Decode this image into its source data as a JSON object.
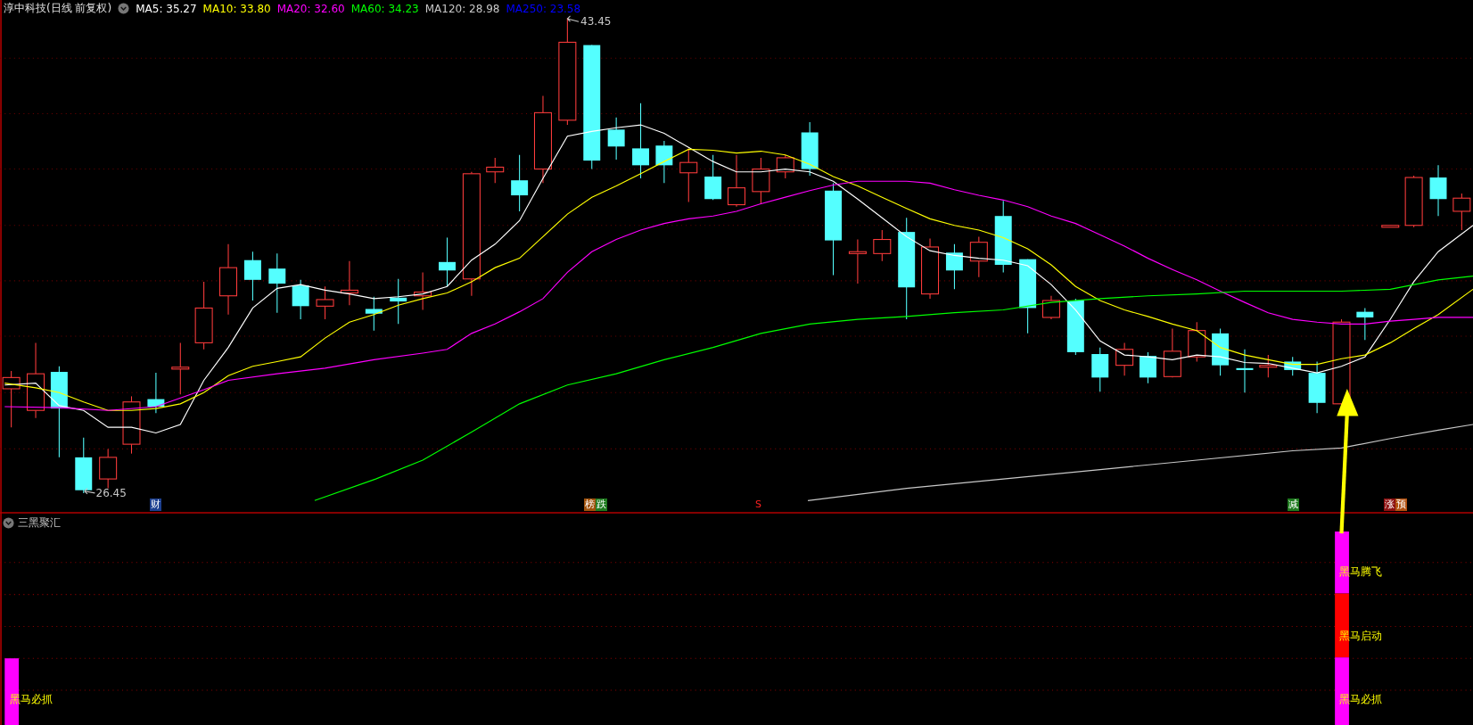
{
  "header": {
    "title": "淳中科技(日线 前复权)",
    "moving_averages": [
      {
        "label": "MA5: 35.27",
        "color": "#ffffff"
      },
      {
        "label": "MA10: 33.80",
        "color": "#ffff00"
      },
      {
        "label": "MA20: 32.60",
        "color": "#ff00ff"
      },
      {
        "label": "MA60: 34.23",
        "color": "#00ff00"
      },
      {
        "label": "MA120: 28.98",
        "color": "#c8c8c8"
      },
      {
        "label": "MA250: 23.58",
        "color": "#0000ff"
      }
    ]
  },
  "price_labels": [
    {
      "text": "43.45"
    },
    {
      "text": "26.45"
    }
  ],
  "markers": [
    {
      "text": "财",
      "color": "#1c3f8f"
    },
    {
      "text": "榜",
      "color": "#a0520c"
    },
    {
      "text": "跌",
      "color": "#1e7a1e"
    },
    {
      "text": "S",
      "color": "#ff2020"
    },
    {
      "text": "减",
      "color": "#1e7a1e"
    },
    {
      "text": "涨",
      "color": "#8c1010"
    },
    {
      "text": "预",
      "color": "#b05010"
    }
  ],
  "indicator": {
    "title": "三黑聚汇",
    "labels": [
      {
        "text": "黑马必抓"
      },
      {
        "text": "黑马腾飞"
      },
      {
        "text": "黑马启动"
      },
      {
        "text": "黑马必抓"
      }
    ]
  }
}
